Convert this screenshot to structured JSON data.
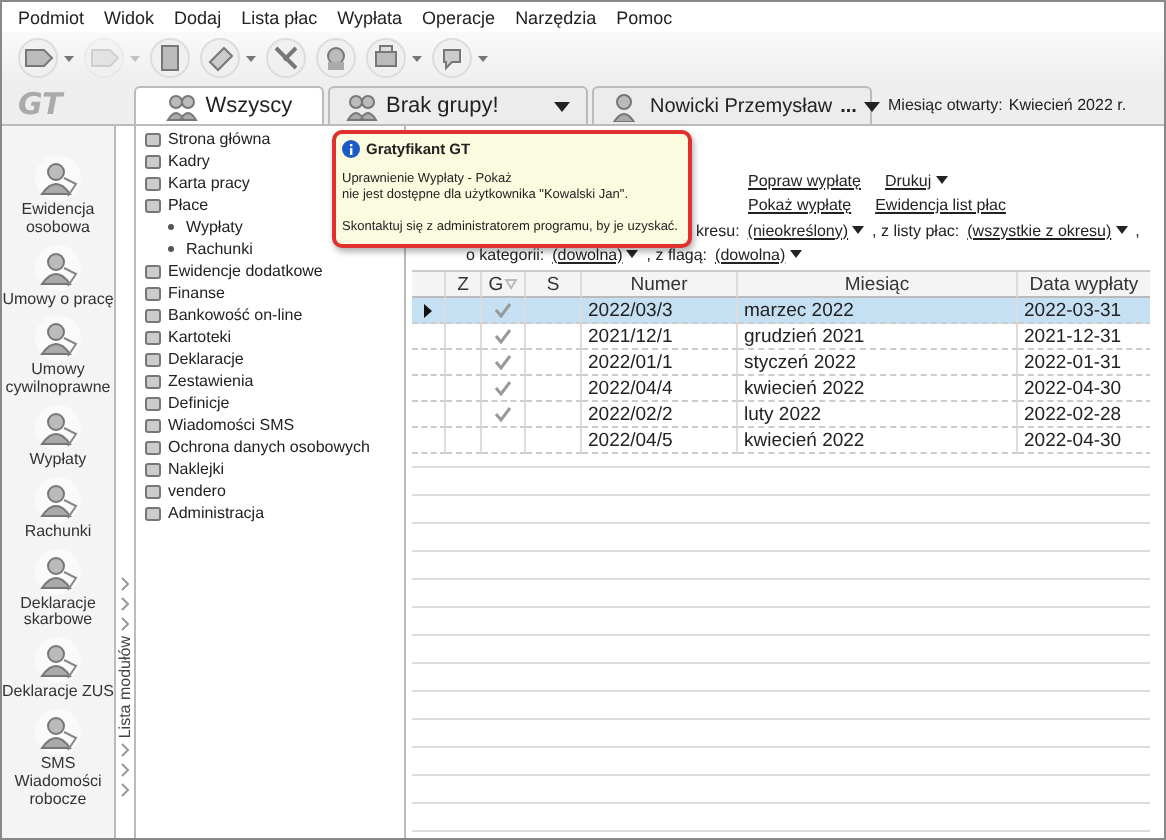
{
  "menu": [
    "Podmiot",
    "Widok",
    "Dodaj",
    "Lista płac",
    "Wypłata",
    "Operacje",
    "Narzędzia",
    "Pomoc"
  ],
  "toolbar": [
    {
      "dropdown": true,
      "disabled": false
    },
    {
      "dropdown": true,
      "disabled": true
    },
    {
      "dropdown": false,
      "disabled": false
    },
    {
      "dropdown": true,
      "disabled": false
    },
    {
      "dropdown": false,
      "disabled": false
    },
    {
      "dropdown": false,
      "disabled": false
    },
    {
      "dropdown": true,
      "disabled": false
    },
    {
      "dropdown": true,
      "disabled": false
    }
  ],
  "logo": "GT",
  "tabs": [
    {
      "label": "Wszyscy",
      "selected": true,
      "dropdown": false
    },
    {
      "label": "Brak grupy!",
      "selected": false,
      "dropdown": true
    },
    {
      "label": "Nowicki Przemysław",
      "selected": false,
      "dropdown": true,
      "more": "..."
    }
  ],
  "open_month": {
    "label": "Miesiąc otwarty:",
    "value": "Kwiecień 2022 r."
  },
  "sidebar": [
    "Ewidencja osobowa",
    "Umowy o pracę",
    "Umowy cywilnoprawne",
    "Wypłaty",
    "Rachunki",
    "Deklaracje skarbowe",
    "Deklaracje ZUS",
    "SMS Wiadomości robocze"
  ],
  "module_strip": {
    "label": "Lista modułów"
  },
  "tree": [
    {
      "label": "Strona główna"
    },
    {
      "label": "Kadry"
    },
    {
      "label": "Karta pracy"
    },
    {
      "label": "Płace",
      "children": [
        {
          "label": "Wypłaty"
        },
        {
          "label": "Rachunki"
        }
      ]
    },
    {
      "label": "Ewidencje dodatkowe"
    },
    {
      "label": "Finanse"
    },
    {
      "label": "Bankowość on-line"
    },
    {
      "label": "Kartoteki"
    },
    {
      "label": "Deklaracje"
    },
    {
      "label": "Zestawienia"
    },
    {
      "label": "Definicje"
    },
    {
      "label": "Wiadomości SMS"
    },
    {
      "label": "Ochrona danych osobowych"
    },
    {
      "label": "Naklejki"
    },
    {
      "label": "vendero"
    },
    {
      "label": "Administracja"
    }
  ],
  "actions": [
    [
      {
        "label": "Popraw wypłatę",
        "dropdown": false
      },
      {
        "label": "Drukuj",
        "dropdown": true
      }
    ],
    [
      {
        "label": "Pokaż wypłatę",
        "dropdown": false
      },
      {
        "label": "Ewidencja list płac",
        "dropdown": false
      }
    ]
  ],
  "filters": [
    [
      {
        "kind": "text",
        "text": "kresu:"
      },
      {
        "kind": "link",
        "text": "(nieokreślony)"
      },
      {
        "kind": "text",
        "text": ", z listy płac:"
      },
      {
        "kind": "link",
        "text": "(wszystkie z okresu)"
      },
      {
        "kind": "text",
        "text": ","
      }
    ],
    [
      {
        "kind": "text",
        "text": "o kategorii:"
      },
      {
        "kind": "link",
        "text": "(dowolna)"
      },
      {
        "kind": "text",
        "text": ", z flagą:"
      },
      {
        "kind": "link",
        "text": "(dowolna)"
      }
    ]
  ],
  "grid": {
    "columns": [
      "Z",
      "G",
      "S",
      "Numer",
      "Miesiąc",
      "Data wypłaty"
    ],
    "rows": [
      {
        "numer": "2022/03/3",
        "miesiac": "marzec 2022",
        "data": "2022-03-31",
        "g_checked": true,
        "selected": true
      },
      {
        "numer": "2021/12/1",
        "miesiac": "grudzień 2021",
        "data": "2021-12-31",
        "g_checked": true,
        "selected": false
      },
      {
        "numer": "2022/01/1",
        "miesiac": "styczeń 2022",
        "data": "2022-01-31",
        "g_checked": true,
        "selected": false
      },
      {
        "numer": "2022/04/4",
        "miesiac": "kwiecień 2022",
        "data": "2022-04-30",
        "g_checked": true,
        "selected": false
      },
      {
        "numer": "2022/02/2",
        "miesiac": "luty 2022",
        "data": "2022-02-28",
        "g_checked": true,
        "selected": false
      },
      {
        "numer": "2022/04/5",
        "miesiac": "kwiecień 2022",
        "data": "2022-04-30",
        "g_checked": false,
        "selected": false
      }
    ]
  },
  "tooltip": {
    "title": "Gratyfikant GT",
    "message": "Uprawnienie Wypłaty - Pokaż\nnie jest dostępne dla użytkownika \"Kowalski Jan\".",
    "note": "Skontaktuj się z administratorem programu, by je uzyskać."
  }
}
